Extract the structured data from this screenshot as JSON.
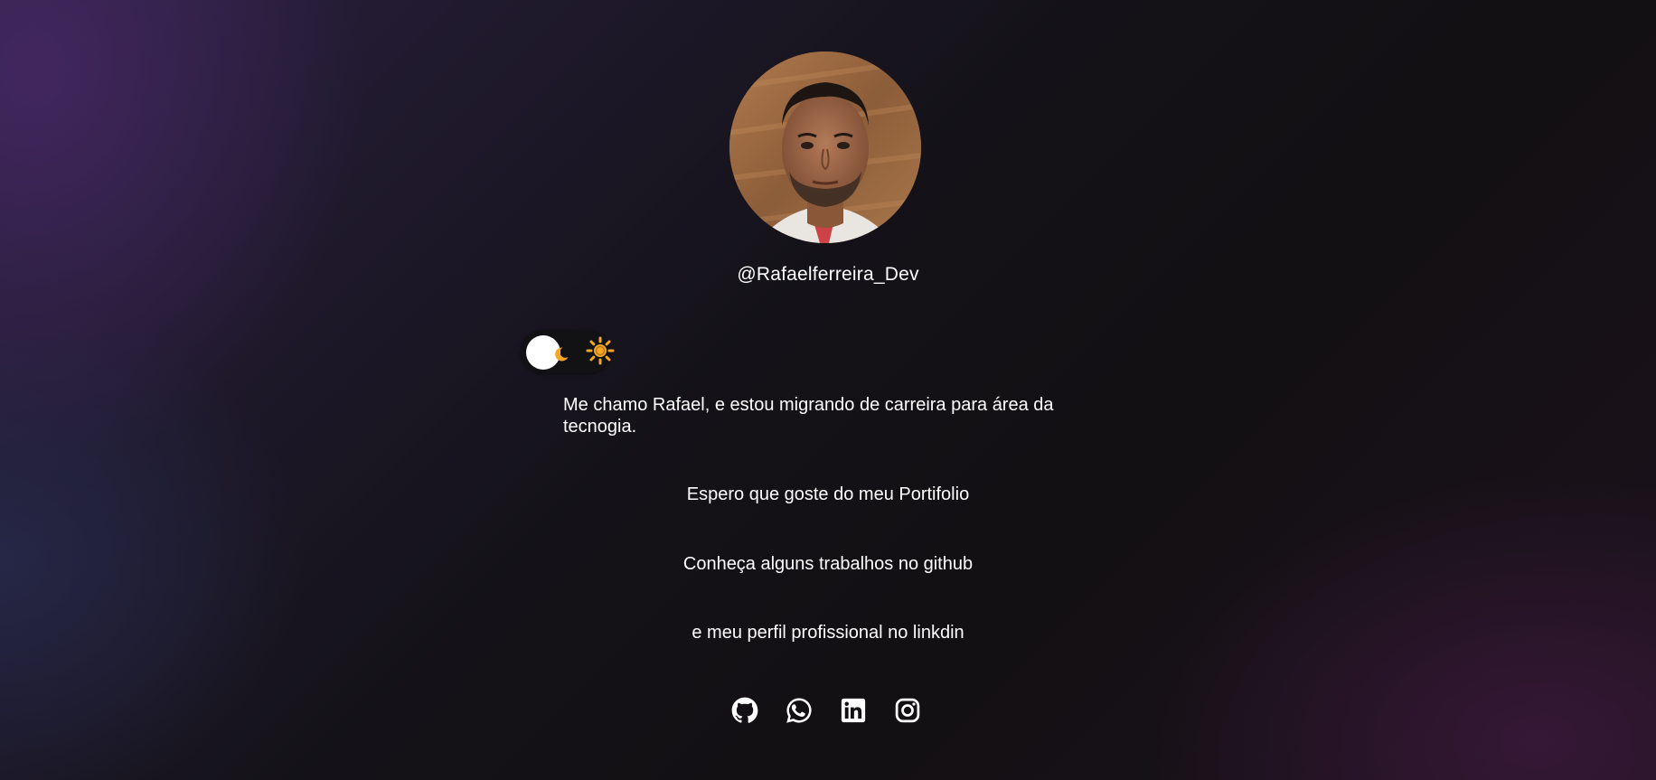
{
  "profile": {
    "handle": "@Rafaelferreira_Dev",
    "avatar_alt": "avatar"
  },
  "theme_toggle": {
    "state": "dark",
    "knob_icon": "moon-icon",
    "mode_icon": "sun-icon",
    "sun_color": "#f5a524"
  },
  "content": {
    "intro": "Me chamo Rafael, e estou migrando de carreira para área da tecnogia.",
    "hope": "Espero que goste do meu Portifolio",
    "github_line": "Conheça alguns trabalhos no github",
    "linkedin_line": "e meu perfil profissional no linkdin"
  },
  "social": [
    {
      "icon": "github-icon"
    },
    {
      "icon": "whatsapp-icon"
    },
    {
      "icon": "linkedin-icon"
    },
    {
      "icon": "instagram-icon"
    }
  ],
  "colors": {
    "text": "#ffffff",
    "background": "#121014",
    "accent": "#f5a524"
  }
}
